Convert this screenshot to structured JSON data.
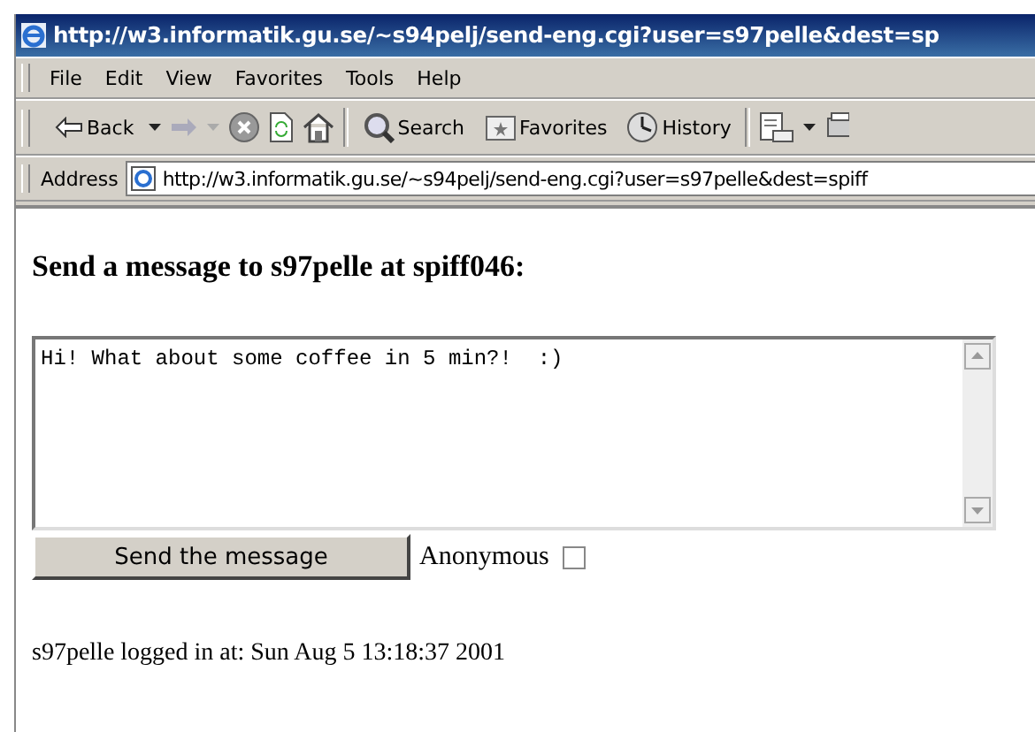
{
  "window": {
    "title": "http://w3.informatik.gu.se/~s94pelj/send-eng.cgi?user=s97pelle&dest=sp"
  },
  "menu": [
    "File",
    "Edit",
    "View",
    "Favorites",
    "Tools",
    "Help"
  ],
  "toolbar": {
    "back": "Back",
    "search": "Search",
    "favorites": "Favorites",
    "history": "History"
  },
  "address": {
    "label": "Address",
    "value": "http://w3.informatik.gu.se/~s94pelj/send-eng.cgi?user=s97pelle&dest=spiff"
  },
  "page": {
    "heading": "Send a message to s97pelle at spiff046:",
    "message": "Hi! What about some coffee in 5 min?!  :)",
    "send_button": "Send the message",
    "anonymous": {
      "label": "Anonymous",
      "checked": false
    },
    "status": "s97pelle logged in at: Sun Aug 5 13:18:37 2001"
  }
}
